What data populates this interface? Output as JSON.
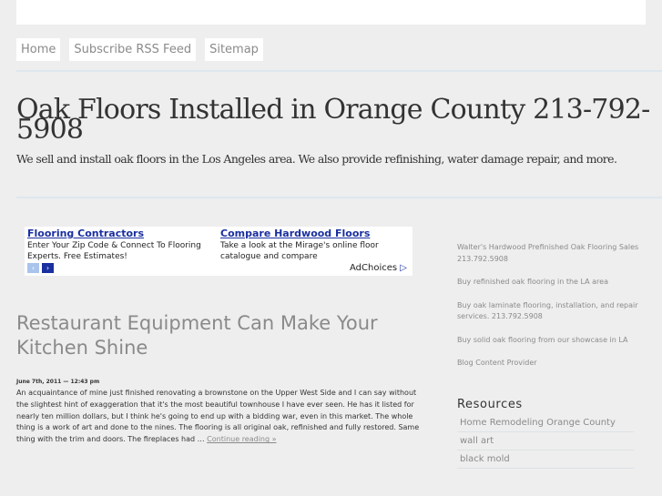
{
  "nav": [
    {
      "label": "Home"
    },
    {
      "label": "Subscribe RSS Feed"
    },
    {
      "label": "Sitemap"
    }
  ],
  "site": {
    "title": "Oak Floors Installed in Orange County 213-792-5908",
    "description": "We sell and install oak floors in the Los Angeles area. We also provide refinishing, water damage repair, and more."
  },
  "ad": {
    "units": [
      {
        "title": "Flooring Contractors",
        "text": "Enter Your Zip Code & Connect To Flooring Experts. Free Estimates!"
      },
      {
        "title": "Compare Hardwood Floors",
        "text": "Take a look at the Mirage's online floor catalogue and compare"
      }
    ],
    "prev_icon": "‹",
    "next_icon": "›",
    "choices_label": "AdChoices",
    "choices_icon": "▷"
  },
  "post": {
    "title": "Restaurant Equipment Can Make Your Kitchen Shine",
    "date": "June 7th, 2011 — 12:43 pm",
    "excerpt": "An acquaintance of mine just finished renovating a brownstone on the Upper West Side and I can say without the slightest hint of exaggeration that it's the most beautiful townhouse I have ever seen. He has it listed for nearly ten million dollars, but I think he's going to end up with a bidding war, even in this market. The whole thing is a work of art and done to the nines. The flooring is all original oak, refinished and fully restored. Same thing with the trim and doors. The fireplaces had …",
    "more": "Continue reading »"
  },
  "sidebar": {
    "links": [
      {
        "label": "Walter's Hardwood Prefinished Oak Flooring Sales 213.792.5908"
      },
      {
        "label": "Buy refinished oak flooring in the LA area"
      },
      {
        "label": "Buy oak laminate flooring, installation, and repair services. 213.792.5908"
      },
      {
        "label": "Buy solid oak flooring from our showcase in LA"
      },
      {
        "label": "Blog Content Provider"
      }
    ],
    "resources_heading": "Resources",
    "resources": [
      {
        "label": "Home Remodeling Orange County"
      },
      {
        "label": "wall art"
      },
      {
        "label": "black mold"
      }
    ]
  }
}
